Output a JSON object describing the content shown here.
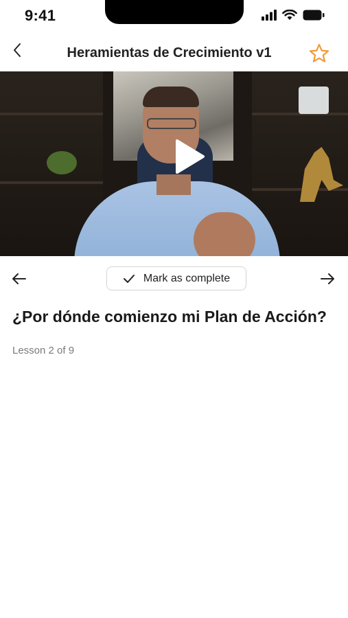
{
  "status_bar": {
    "time": "9:41",
    "icons": [
      "signal-icon",
      "wifi-icon",
      "battery-icon"
    ]
  },
  "header": {
    "title": "Heramientas de Crecimiento v1",
    "back_icon": "chevron-left-icon",
    "favorite_icon": "star-outline-icon"
  },
  "video": {
    "play_icon": "play-icon"
  },
  "lesson_nav": {
    "prev_icon": "arrow-left-icon",
    "next_icon": "arrow-right-icon",
    "complete_label": "Mark as complete",
    "complete_icon": "checkmark-icon"
  },
  "lesson": {
    "title": "¿Por dónde comienzo mi Plan de Acción?",
    "meta": "Lesson 2 of 9"
  },
  "colors": {
    "accent_star": "#f29a38",
    "text_primary": "#1a1a1a",
    "text_secondary": "#7a7a7a",
    "border": "#d4d4d4"
  }
}
